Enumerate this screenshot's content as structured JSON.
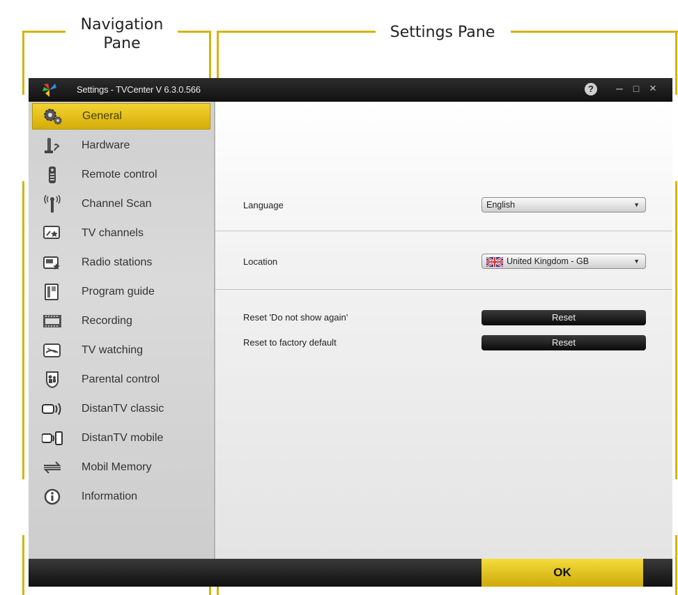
{
  "annotations": {
    "navigation_pane": "Navigation\nPane",
    "navigation_pane_line1": "Navigation",
    "navigation_pane_line2": "Pane",
    "settings_pane": "Settings Pane",
    "color": "#d2b40a"
  },
  "window": {
    "title": "Settings  -  TVCenter   V 6.3.0.566",
    "help_icon": "question-icon",
    "minimize_glyph": "–",
    "maximize_glyph": "□",
    "close_glyph": "×"
  },
  "nav": {
    "active_color": "#e6c11a",
    "items": [
      {
        "label": "General",
        "icon": "gears-icon",
        "active": true
      },
      {
        "label": "Hardware",
        "icon": "hardware-icon"
      },
      {
        "label": "Remote control",
        "icon": "remote-icon"
      },
      {
        "label": "Channel Scan",
        "icon": "antenna-icon"
      },
      {
        "label": "TV channels",
        "icon": "tv-star-icon"
      },
      {
        "label": "Radio stations",
        "icon": "radio-star-icon"
      },
      {
        "label": "Program guide",
        "icon": "guide-icon"
      },
      {
        "label": "Recording",
        "icon": "film-icon"
      },
      {
        "label": "TV watching",
        "icon": "tv-watch-icon"
      },
      {
        "label": "Parental control",
        "icon": "shield-people-icon"
      },
      {
        "label": "DistanTV classic",
        "icon": "distantv-classic-icon"
      },
      {
        "label": "DistanTV mobile",
        "icon": "distantv-mobile-icon"
      },
      {
        "label": "Mobil Memory",
        "icon": "transfer-arrows-icon"
      },
      {
        "label": "Information",
        "icon": "info-icon"
      }
    ]
  },
  "settings": {
    "language": {
      "label": "Language",
      "value": "English"
    },
    "location": {
      "label": "Location",
      "value": "United Kingdom - GB",
      "flag": "uk-flag-icon"
    },
    "reset_dont_show": {
      "label": "Reset 'Do not show again'",
      "button": "Reset"
    },
    "reset_factory": {
      "label": "Reset to factory default",
      "button": "Reset"
    }
  },
  "footer": {
    "ok_label": "OK"
  }
}
